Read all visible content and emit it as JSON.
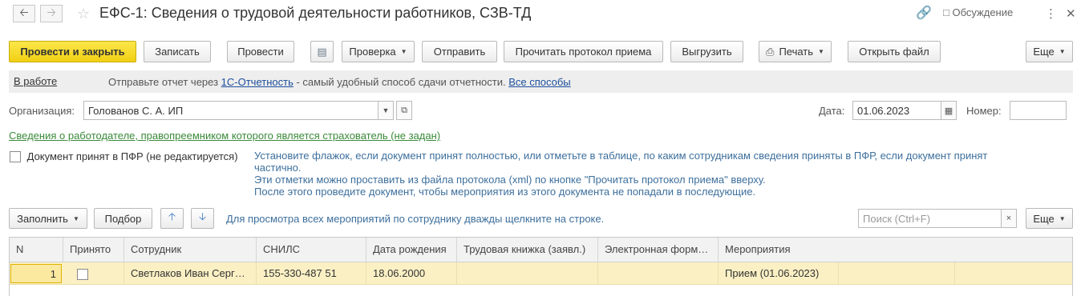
{
  "window": {
    "title": "ЕФС-1: Сведения о трудовой деятельности работников, СЗВ-ТД",
    "discussion_label": "Обсуждение"
  },
  "toolbar": {
    "post_close": "Провести и закрыть",
    "save": "Записать",
    "post": "Провести",
    "check": "Проверка",
    "send": "Отправить",
    "read_protocol": "Прочитать протокол приема",
    "export": "Выгрузить",
    "print": "Печать",
    "open_file": "Открыть файл",
    "more": "Еще"
  },
  "infobar": {
    "status": "В работе",
    "text_before": "Отправьте отчет через ",
    "link1": "1С-Отчетность",
    "text_middle": " - самый удобный способ сдачи отчетности. ",
    "link2": "Все способы"
  },
  "form": {
    "org_label": "Организация:",
    "org_value": "Голованов С. А. ИП",
    "date_label": "Дата:",
    "date_value": "01.06.2023",
    "number_label": "Номер:",
    "number_value": "",
    "employer_link": "Сведения о работодателе, правопреемником которого является страхователь (не задан)",
    "accepted_label": "Документ принят в ПФР (не редактируется)",
    "hint_line1": "Установите флажок, если документ принят полностью, или отметьте в таблице, по каким сотрудникам сведения приняты в ПФР, если документ принят",
    "hint_line2": "частично.",
    "hint_line3": "Эти отметки можно проставить из файла протокола (xml) по кнопке \"Прочитать протокол приема\" вверху.",
    "hint_line4": "После этого проведите документ, чтобы мероприятия из этого документа не попадали в последующие."
  },
  "table_toolbar": {
    "fill": "Заполнить",
    "pick": "Подбор",
    "hint": "Для просмотра всех мероприятий по сотруднику дважды щелкните на строке.",
    "search_placeholder": "Поиск (Ctrl+F)",
    "more": "Еще"
  },
  "table": {
    "columns": [
      "N",
      "Принято",
      "Сотрудник",
      "СНИЛС",
      "Дата рождения",
      "Трудовая книжка (заявл.)",
      "Электронная форм…",
      "Мероприятия"
    ],
    "rows": [
      {
        "n": "1",
        "accepted": false,
        "employee": "Светлаков Иван Серг…",
        "snils": "155-330-487 51",
        "birth_date": "18.06.2000",
        "work_book": "",
        "electronic": "",
        "events": "Прием (01.06.2023)"
      }
    ]
  },
  "colors": {
    "primary_button": "#f2cf13",
    "link": "#1c4f9c",
    "green_link": "#3a8a3a",
    "hint_text": "#3d6f9c",
    "selected_row": "#fbf0c4"
  },
  "icons": [
    "back-arrow-icon",
    "forward-arrow-icon",
    "star-icon",
    "link-icon",
    "discussion-icon",
    "more-vertical-icon",
    "close-icon",
    "journal-icon",
    "printer-icon",
    "calendar-icon",
    "open-in-new-icon",
    "up-arrow-icon",
    "down-arrow-icon",
    "clear-icon"
  ]
}
